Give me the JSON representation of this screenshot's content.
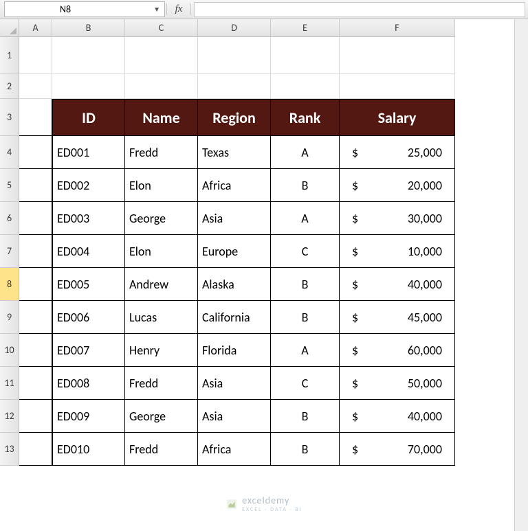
{
  "namebox": {
    "value": "N8"
  },
  "fx_label": "fx",
  "formula": "",
  "columns": [
    {
      "letter": "A",
      "width": 48
    },
    {
      "letter": "B",
      "width": 106
    },
    {
      "letter": "C",
      "width": 106
    },
    {
      "letter": "D",
      "width": 106
    },
    {
      "letter": "E",
      "width": 100
    },
    {
      "letter": "F",
      "width": 168
    }
  ],
  "rows": [
    {
      "num": "1",
      "height": 54
    },
    {
      "num": "2",
      "height": 36
    },
    {
      "num": "3",
      "height": 54
    },
    {
      "num": "4",
      "height": 48
    },
    {
      "num": "5",
      "height": 48
    },
    {
      "num": "6",
      "height": 48
    },
    {
      "num": "7",
      "height": 48
    },
    {
      "num": "8",
      "height": 48,
      "active": true
    },
    {
      "num": "9",
      "height": 48
    },
    {
      "num": "10",
      "height": 48
    },
    {
      "num": "11",
      "height": 48
    },
    {
      "num": "12",
      "height": 48
    },
    {
      "num": "13",
      "height": 48
    }
  ],
  "table": {
    "headers": [
      "ID",
      "Name",
      "Region",
      "Rank",
      "Salary"
    ],
    "currency": "$",
    "rows": [
      {
        "id": "ED001",
        "name": "Fredd",
        "region": "Texas",
        "rank": "A",
        "salary": "25,000"
      },
      {
        "id": "ED002",
        "name": "Elon",
        "region": "Africa",
        "rank": "B",
        "salary": "20,000"
      },
      {
        "id": "ED003",
        "name": "George",
        "region": "Asia",
        "rank": "A",
        "salary": "30,000"
      },
      {
        "id": "ED004",
        "name": "Elon",
        "region": "Europe",
        "rank": "C",
        "salary": "10,000"
      },
      {
        "id": "ED005",
        "name": "Andrew",
        "region": "Alaska",
        "rank": "B",
        "salary": "40,000"
      },
      {
        "id": "ED006",
        "name": "Lucas",
        "region": "California",
        "rank": "B",
        "salary": "45,000"
      },
      {
        "id": "ED007",
        "name": "Henry",
        "region": "Florida",
        "rank": "A",
        "salary": "60,000"
      },
      {
        "id": "ED008",
        "name": "Fredd",
        "region": "Asia",
        "rank": "C",
        "salary": "50,000"
      },
      {
        "id": "ED009",
        "name": "George",
        "region": "Asia",
        "rank": "B",
        "salary": "40,000"
      },
      {
        "id": "ED010",
        "name": "Fredd",
        "region": "Africa",
        "rank": "B",
        "salary": "70,000"
      }
    ]
  },
  "watermark": {
    "text": "exceldemy",
    "sub": "EXCEL · DATA · BI"
  }
}
